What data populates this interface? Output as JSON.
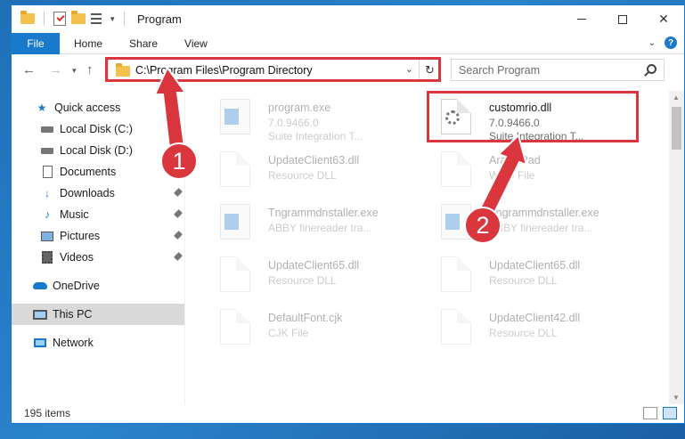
{
  "window": {
    "title": "Program",
    "controls": [
      "minimize",
      "maximize",
      "close"
    ]
  },
  "ribbon": {
    "tabs": [
      "File",
      "Home",
      "Share",
      "View"
    ]
  },
  "nav": {
    "address": "C:\\Program Files\\Program Directory",
    "search_placeholder": "Search Program"
  },
  "sidebar": {
    "items": [
      {
        "label": "Quick access",
        "icon": "star-icon",
        "pinned": false
      },
      {
        "label": "Local Disk (C:)",
        "icon": "drive-icon",
        "pinned": true
      },
      {
        "label": "Local Disk (D:)",
        "icon": "drive-icon",
        "pinned": false
      },
      {
        "label": "Documents",
        "icon": "documents-icon",
        "pinned": false
      },
      {
        "label": "Downloads",
        "icon": "downloads-icon",
        "pinned": true
      },
      {
        "label": "Music",
        "icon": "music-icon",
        "pinned": true
      },
      {
        "label": "Pictures",
        "icon": "pictures-icon",
        "pinned": true
      },
      {
        "label": "Videos",
        "icon": "videos-icon",
        "pinned": true
      },
      {
        "label": "OneDrive",
        "icon": "onedrive-icon",
        "pinned": false
      },
      {
        "label": "This PC",
        "icon": "pc-icon",
        "pinned": false,
        "selected": true
      },
      {
        "label": "Network",
        "icon": "network-icon",
        "pinned": false
      }
    ]
  },
  "files": [
    {
      "name": "program.exe",
      "line1": "7.0.9466.0",
      "line2": "Suite Integration T...",
      "type": "exe",
      "faded": true
    },
    {
      "name": "customrio.dll",
      "line1": "7.0.9466.0",
      "line2": "Suite Integration T...",
      "type": "dll",
      "faded": false
    },
    {
      "name": "UpdateClient63.dll",
      "line1": "Resource DLL",
      "line2": "",
      "type": "doc",
      "faded": true
    },
    {
      "name": "ArabicPad",
      "line1": "WRD File",
      "line2": "",
      "type": "doc",
      "faded": true
    },
    {
      "name": "Tngrammdnstaller.exe",
      "line1": "ABBY finereader tra...",
      "line2": "",
      "type": "exe",
      "faded": true
    },
    {
      "name": "Tngrammdnstaller.exe",
      "line1": "ABBY finereader tra...",
      "line2": "",
      "type": "exe",
      "faded": true
    },
    {
      "name": "UpdateClient65.dll",
      "line1": "Resource DLL",
      "line2": "",
      "type": "doc",
      "faded": true
    },
    {
      "name": "UpdateClient65.dll",
      "line1": "Resource DLL",
      "line2": "",
      "type": "doc",
      "faded": true
    },
    {
      "name": "DefaultFont.cjk",
      "line1": "CJK File",
      "line2": "",
      "type": "doc",
      "faded": true
    },
    {
      "name": "UpdateClient42.dll",
      "line1": "Resource DLL",
      "line2": "",
      "type": "doc",
      "faded": true
    }
  ],
  "status": {
    "item_count": "195 items"
  },
  "annotations": {
    "badge1": "1",
    "badge2": "2",
    "color": "#d9363e"
  }
}
